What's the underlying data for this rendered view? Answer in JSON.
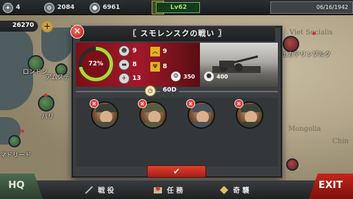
{
  "topbar": {
    "medals": "4",
    "iron": "2084",
    "oil": "6961",
    "level": "Lv62",
    "date": "06/16/1942"
  },
  "coins": "26270",
  "map_labels": [
    "ロンドン",
    "アムステ",
    "パリ",
    "マドリード",
    "エカテリンブルク"
  ],
  "map_faint": [
    "Viet Socialis",
    "Mongolia",
    "Chin"
  ],
  "dialog": {
    "title": "〖 スモレンスクの戦い 〗",
    "progress": 72,
    "progress_label": "72%",
    "units": [
      {
        "icon": "infantry-icon",
        "value": "9"
      },
      {
        "icon": "tank-icon",
        "value": "8"
      },
      {
        "icon": "artillery-icon",
        "value": "13"
      }
    ],
    "ranks": [
      {
        "icon": "rank-chevron-icon",
        "value": "9"
      },
      {
        "icon": "rank-wings-icon",
        "value": "8"
      }
    ],
    "rewards": [
      {
        "icon": "gear-icon",
        "value": "350"
      },
      {
        "icon": "oil-icon",
        "value": "400"
      }
    ],
    "timer": "60D",
    "generals": [
      {
        "name": "general-1",
        "remove": "×"
      },
      {
        "name": "general-2",
        "remove": "×"
      },
      {
        "name": "general-3",
        "remove": "×"
      },
      {
        "name": "general-4",
        "remove": "×"
      }
    ],
    "close": "×",
    "confirm": "✔"
  },
  "bottom": {
    "hq": "HQ",
    "campaign": "戦 役",
    "mission": "任 務",
    "conquest": "奇 襲",
    "exit": "EXIT"
  },
  "colors": {
    "accent_red": "#c4261c",
    "progress_green": "#9ee030",
    "level_green": "#79b65a"
  }
}
